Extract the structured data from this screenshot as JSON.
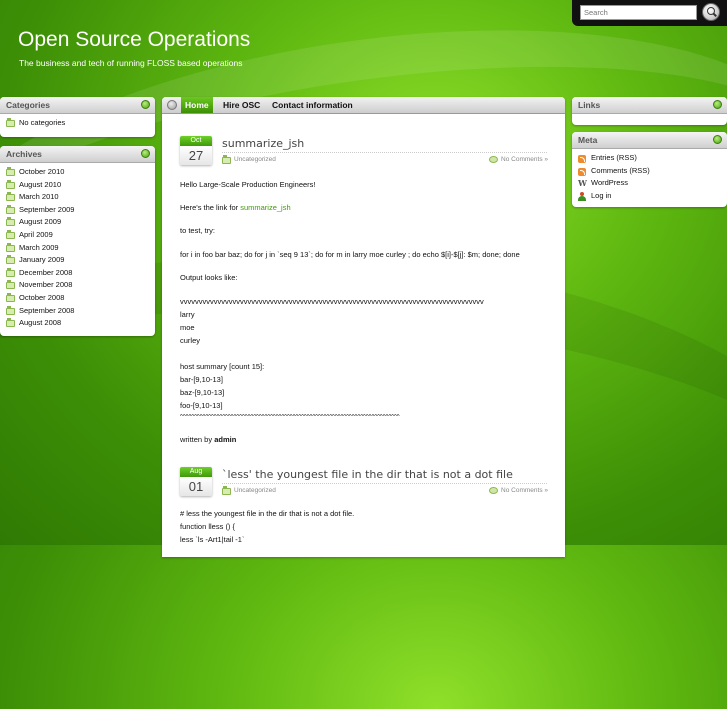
{
  "site": {
    "title": "Open Source Operations",
    "description": "The business and tech of running FLOSS based operations"
  },
  "search": {
    "placeholder": "Search",
    "icon": "magnifier-icon"
  },
  "sidebar_left": {
    "categories": {
      "title": "Categories",
      "items": [
        "No categories"
      ]
    },
    "archives": {
      "title": "Archives",
      "items": [
        "October 2010",
        "August 2010",
        "March 2010",
        "September 2009",
        "August 2009",
        "April 2009",
        "March 2009",
        "January 2009",
        "December 2008",
        "November 2008",
        "October 2008",
        "September 2008",
        "August 2008"
      ]
    }
  },
  "sidebar_right": {
    "links": {
      "title": "Links"
    },
    "meta": {
      "title": "Meta",
      "items": [
        "Entries (RSS)",
        "Comments (RSS)",
        "WordPress",
        "Log in"
      ]
    }
  },
  "nav": {
    "items": [
      "Home",
      "Hire OSC",
      "Contact information"
    ]
  },
  "posts": [
    {
      "month": "Oct",
      "day": "27",
      "title": "summarize_jsh",
      "category": "Uncategorized",
      "comments": "No Comments »",
      "greeting": "Hello Large-Scale Production Engineers!",
      "link_intro": "Here's the link for ",
      "link_text": "summarize_jsh",
      "test_line": "to test, try:",
      "command": "for i in foo bar baz; do for j in `seq 9 13`; do for m in larry moe curley ; do  echo $[i]-$[j]: $m; done; done",
      "output_label": "Output looks like:",
      "out_v": "vvvvvvvvvvvvvvvvvvvvvvvvvvvvvvvvvvvvvvvvvvvvvvvvvvvvvvvvvvvvvvvvvvvvvvvvvvvvvvvvv",
      "out_1": "larry",
      "out_2": "moe",
      "out_3": "curley",
      "summary": "host summary [count 15]:",
      "sum_1": "bar-[9,10-13]",
      "sum_2": "baz-[9,10-13]",
      "sum_3": "foo-[9,10-13]",
      "out_caret": "^^^^^^^^^^^^^^^^^^^^^^^^^^^^^^^^^^^^^^^^^^^^^^^^^^^^^^^^^^^^^^^^^^^^^^^^^^^^^^",
      "written_by": "written by ",
      "author": "admin"
    },
    {
      "month": "Aug",
      "day": "01",
      "title": "`less' the youngest file in the dir that is not a dot file",
      "category": "Uncategorized",
      "comments": "No Comments »",
      "line_1": "# less the youngest file in the dir that is not a dot file.",
      "line_2": "function lless () {",
      "line_3": "less `ls -Art1|tail -1`"
    }
  ]
}
